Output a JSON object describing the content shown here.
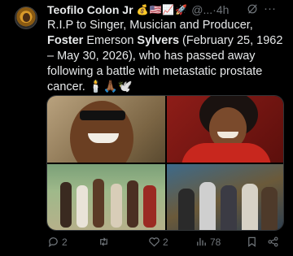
{
  "post": {
    "author_name": "Teofilo Colon Jr",
    "author_emojis": "💰🇺🇸📈🚀",
    "handle": "@...",
    "time_sep": " · ",
    "time": "4h",
    "text_intro": "R.I.P to Singer, Musician and Producer, ",
    "text_name_first": "Foster",
    "text_name_mid": " Emerson ",
    "text_name_last": "Sylvers",
    "text_rest": " (February 25, 1962 – May 30, 2026), who has passed away following a battle with metastatic prostate cancer. 🕯️🙏🏾🕊️",
    "more_label": "···"
  },
  "actions": {
    "replies": "2",
    "reposts": "",
    "likes": "2",
    "views": "78"
  },
  "colors": {
    "background": "#000000",
    "text": "#e7e9ea",
    "muted": "#71767b"
  }
}
